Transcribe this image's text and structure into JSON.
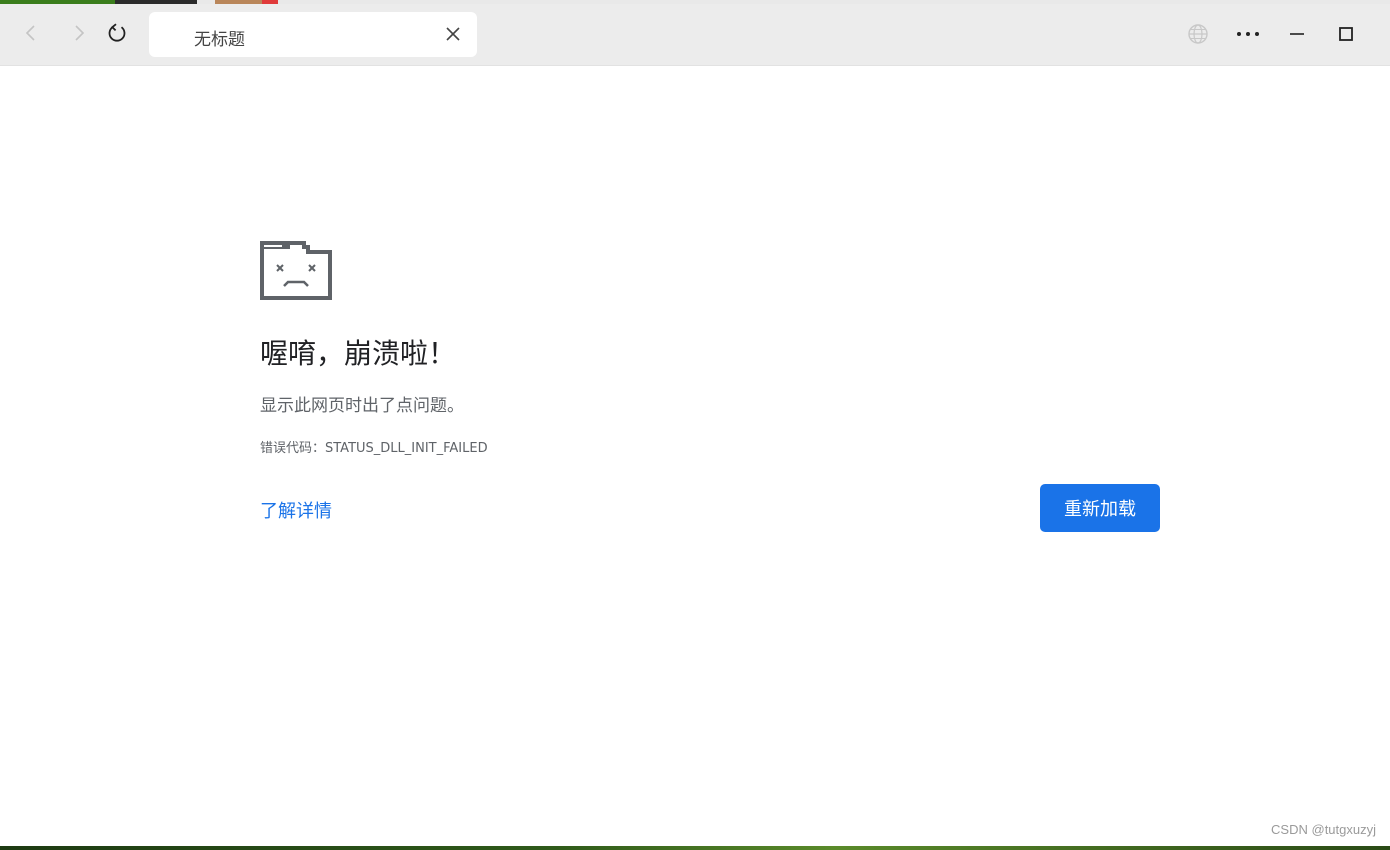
{
  "tab": {
    "title": "无标题"
  },
  "toolbar": {
    "icons": [
      "back-icon",
      "forward-icon",
      "reload-icon",
      "globe-icon",
      "more-icon",
      "minimize-icon",
      "maximize-icon",
      "close-icon"
    ]
  },
  "error_page": {
    "heading": "喔唷，崩溃啦！",
    "message": "显示此网页时出了点问题。",
    "error_code": "错误代码：STATUS_DLL_INIT_FAILED",
    "learn_more": "了解详情",
    "reload_button": "重新加载"
  },
  "watermark": "CSDN @tutgxuzyj",
  "colors": {
    "accent": "#1a73e8",
    "toolbar_bg": "#ececec",
    "heading": "#202124",
    "secondary_text": "#5f6368"
  }
}
